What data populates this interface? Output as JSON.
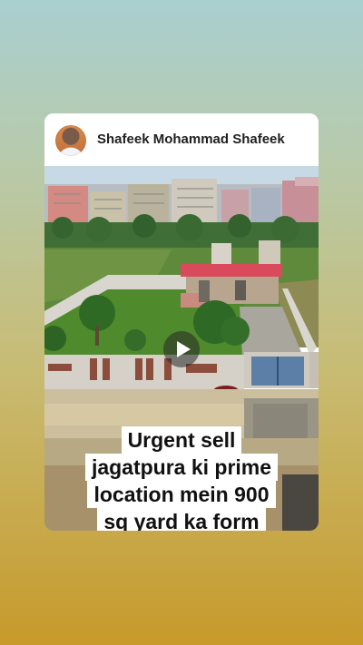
{
  "post": {
    "author_name": "Shafeek Mohammad Shafeek",
    "avatar_icon": "user-avatar",
    "caption_lines": [
      "Urgent sell",
      "jagatpura ki prime",
      "location mein 900",
      "sq yard ka form"
    ],
    "play_icon": "play-icon"
  }
}
